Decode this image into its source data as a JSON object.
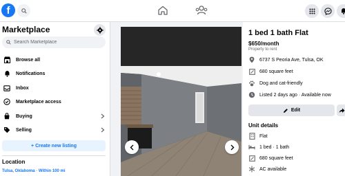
{
  "header": {
    "logo_letter": "f",
    "icons": [
      "facebook-logo",
      "search-icon",
      "home-icon",
      "groups-icon",
      "menu-grid-icon",
      "messenger-icon",
      "notifications-icon"
    ]
  },
  "sidebar": {
    "title": "Marketplace",
    "search_placeholder": "Search Marketplace",
    "items": [
      {
        "label": "Browse all",
        "icon": "storefront-icon"
      },
      {
        "label": "Notifications",
        "icon": "bell-icon"
      },
      {
        "label": "Inbox",
        "icon": "inbox-icon"
      },
      {
        "label": "Marketplace access",
        "icon": "access-icon"
      },
      {
        "label": "Buying",
        "icon": "bag-icon"
      },
      {
        "label": "Selling",
        "icon": "tag-icon"
      }
    ],
    "create_button": "+ Create new listing",
    "location_title": "Location",
    "location_value": "Tulsa, Oklahoma · Within 100 mi"
  },
  "listing": {
    "title": "1 bed 1 bath Flat",
    "price": "$650/month",
    "subtitle": "Property to rent",
    "details": [
      {
        "text": "6737 S Peoria Ave, Tulsa, OK",
        "icon": "location-pin-icon"
      },
      {
        "text": "680 square feet",
        "icon": "area-icon"
      },
      {
        "text": "Dog and cat-friendly",
        "icon": "paw-icon"
      },
      {
        "text": "Listed 2 days ago · Available now",
        "icon": "clock-icon"
      }
    ],
    "edit_label": "Edit",
    "unit_details_title": "Unit details",
    "unit_details": [
      {
        "text": "Flat",
        "icon": "building-icon"
      },
      {
        "text": "1 bed · 1 bath",
        "icon": "bed-icon"
      },
      {
        "text": "680 square feet",
        "icon": "area-icon"
      },
      {
        "text": "AC available",
        "icon": "snowflake-icon"
      }
    ]
  },
  "colors": {
    "brand": "#1877f2",
    "page_bg": "#f0f2f5",
    "button_gray": "#e4e6eb",
    "text_secondary": "#65676b"
  }
}
